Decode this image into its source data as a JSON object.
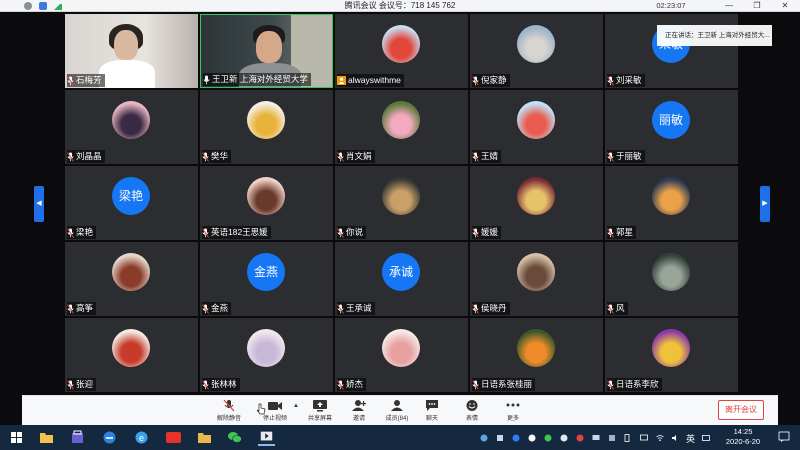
{
  "window": {
    "title": "腾讯会议  会议号：718 145 762",
    "timer": "02:23:07",
    "controls": [
      "minimize-icon",
      "restore-icon",
      "close-icon"
    ]
  },
  "speaker_notice": "正在讲话：王卫新 上海对外经贸大...",
  "participants": [
    {
      "name": "石梅芳",
      "kind": "video"
    },
    {
      "name": "王卫新 上海对外经贸大学",
      "kind": "video",
      "speaking": true
    },
    {
      "name": "alwayswithme",
      "kind": "photo",
      "host": true
    },
    {
      "name": "倪家静",
      "kind": "photo"
    },
    {
      "name": "刘采敏",
      "kind": "text",
      "avatar_text": "采敏"
    },
    {
      "name": "刘晶晶",
      "kind": "photo"
    },
    {
      "name": "樊华",
      "kind": "photo"
    },
    {
      "name": "肖文娟",
      "kind": "photo"
    },
    {
      "name": "王婧",
      "kind": "photo"
    },
    {
      "name": "于丽敏",
      "kind": "text",
      "avatar_text": "丽敏"
    },
    {
      "name": "梁艳",
      "kind": "text",
      "avatar_text": "梁艳"
    },
    {
      "name": "英语182王思媛",
      "kind": "photo"
    },
    {
      "name": "你说",
      "kind": "photo"
    },
    {
      "name": "媛媛",
      "kind": "photo"
    },
    {
      "name": "郭星",
      "kind": "photo"
    },
    {
      "name": "高筝",
      "kind": "photo"
    },
    {
      "name": "金燕",
      "kind": "text",
      "avatar_text": "金燕"
    },
    {
      "name": "王承诚",
      "kind": "text",
      "avatar_text": "承诚"
    },
    {
      "name": "侯晓丹",
      "kind": "photo"
    },
    {
      "name": "风",
      "kind": "photo"
    },
    {
      "name": "张迎",
      "kind": "photo"
    },
    {
      "name": "张林林",
      "kind": "photo"
    },
    {
      "name": "娇杰",
      "kind": "photo"
    },
    {
      "name": "日语系张桂丽",
      "kind": "photo"
    },
    {
      "name": "日语系李欣",
      "kind": "photo"
    }
  ],
  "toolbar": {
    "unmute": "解除静音",
    "stop_video": "停止视频",
    "share_screen": "共享屏幕",
    "invite": "邀请",
    "members": "成员(84)",
    "chat": "聊天",
    "reactions": "表情",
    "more": "更多",
    "leave": "离开会议"
  },
  "taskbar": {
    "ime": "英",
    "time": "14:25",
    "date": "2020-6-20"
  },
  "colors": {
    "accent": "#1677f5",
    "tile": "#2c2d31",
    "leave": "#e0443e",
    "speaking_border": "#34c759"
  }
}
